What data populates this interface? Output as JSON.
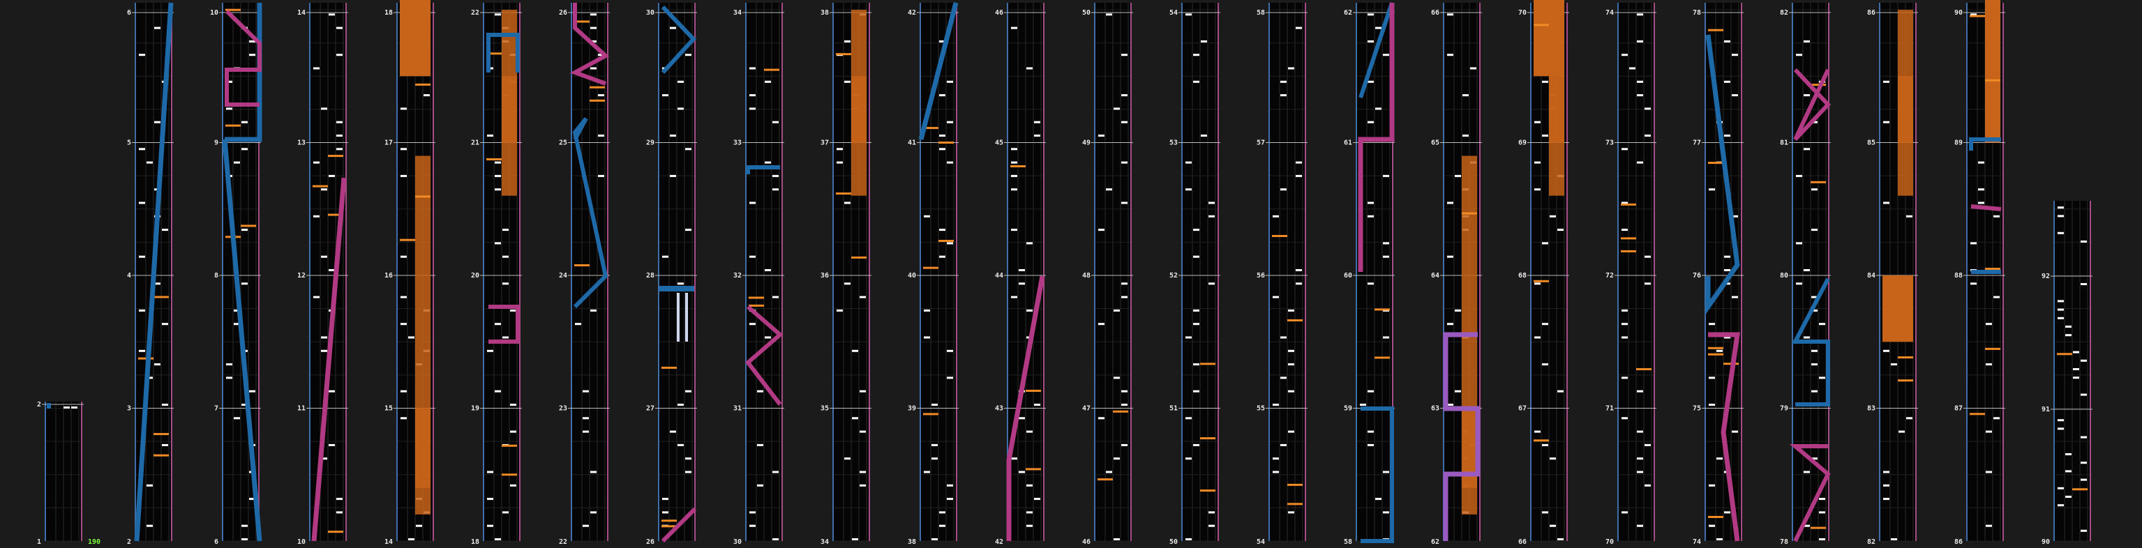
{
  "chart": {
    "bpm_label": "190",
    "colors": {
      "background": "#1b1b1b",
      "column_bg": "#050505",
      "lane_line": "#2b2b2b",
      "edge_left": "#3f6ea8",
      "edge_right": "#a64c86",
      "measure_line": "#bcbcbc",
      "chip": "#ffffff",
      "fx_chip": "#f08a24",
      "fx_hold": "#c8641a",
      "laser_left": "#1e6aa8",
      "laser_right": "#b23a84",
      "laser_purple": "#9b5abf",
      "bt_hold": "#cfd6ee",
      "bpm_text": "#7cff3a"
    }
  },
  "columns": [
    {
      "measures": [
        "1",
        "2"
      ]
    },
    {
      "measures": [
        "2",
        "3",
        "4",
        "5",
        "6"
      ]
    },
    {
      "measures": [
        "6",
        "7",
        "8",
        "9",
        "10"
      ]
    },
    {
      "measures": [
        "10",
        "11",
        "12",
        "13",
        "14"
      ]
    },
    {
      "measures": [
        "14",
        "15",
        "16",
        "17",
        "18"
      ]
    },
    {
      "measures": [
        "18",
        "19",
        "20",
        "21",
        "22"
      ]
    },
    {
      "measures": [
        "22",
        "23",
        "24",
        "25",
        "26"
      ]
    },
    {
      "measures": [
        "26",
        "27",
        "28",
        "29",
        "30"
      ]
    },
    {
      "measures": [
        "30",
        "31",
        "32",
        "33",
        "34"
      ]
    },
    {
      "measures": [
        "34",
        "35",
        "36",
        "37",
        "38"
      ]
    },
    {
      "measures": [
        "38",
        "39",
        "40",
        "41",
        "42"
      ]
    },
    {
      "measures": [
        "42",
        "43",
        "44",
        "45",
        "46"
      ]
    },
    {
      "measures": [
        "46",
        "47",
        "48",
        "49",
        "50"
      ]
    },
    {
      "measures": [
        "50",
        "51",
        "52",
        "53",
        "54"
      ]
    },
    {
      "measures": [
        "54",
        "55",
        "56",
        "57",
        "58"
      ]
    },
    {
      "measures": [
        "58",
        "59",
        "60",
        "61",
        "62"
      ]
    },
    {
      "measures": [
        "62",
        "63",
        "64",
        "65",
        "66"
      ]
    },
    {
      "measures": [
        "66",
        "67",
        "68",
        "69",
        "70"
      ]
    },
    {
      "measures": [
        "70",
        "71",
        "72",
        "73",
        "74"
      ]
    },
    {
      "measures": [
        "74",
        "75",
        "76",
        "77",
        "78"
      ]
    },
    {
      "measures": [
        "78",
        "79",
        "80",
        "81",
        "82"
      ]
    },
    {
      "measures": [
        "82",
        "83",
        "84",
        "85",
        "86"
      ]
    },
    {
      "measures": [
        "86",
        "87",
        "88",
        "89",
        "90"
      ]
    },
    {
      "measures": [
        "90",
        "91",
        "92"
      ]
    }
  ]
}
